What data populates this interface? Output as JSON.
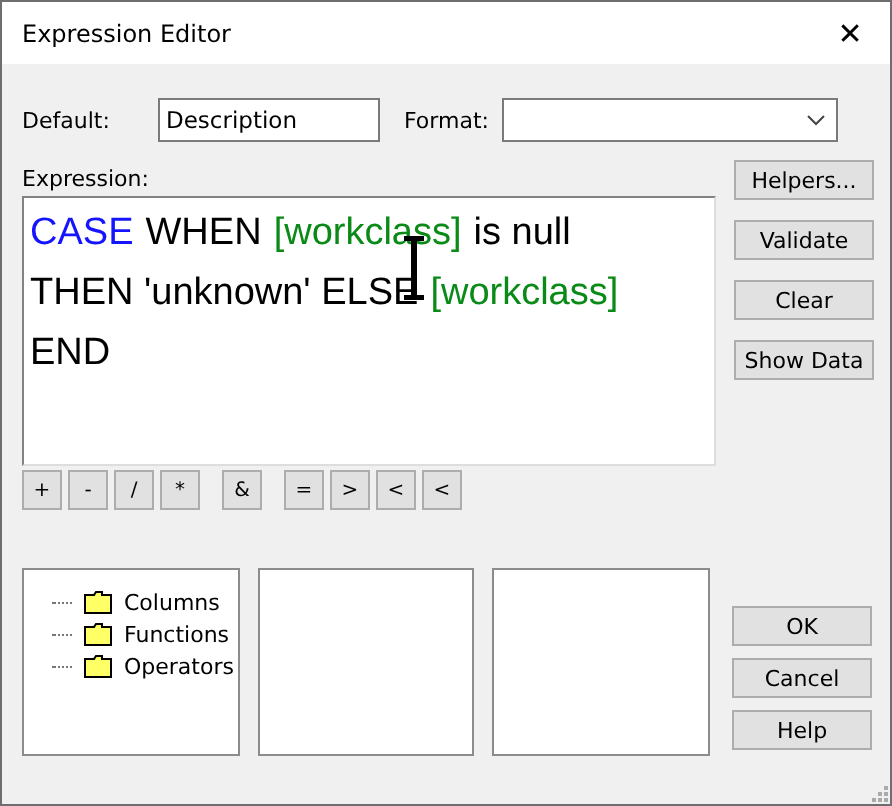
{
  "window": {
    "title": "Expression Editor",
    "close": "✕"
  },
  "default": {
    "label": "Default:",
    "value": "Description"
  },
  "format": {
    "label": "Format:"
  },
  "expression": {
    "label": "Expression:",
    "lines": [
      [
        {
          "text": "CASE",
          "kind": "keyword"
        },
        {
          "text": "WHEN",
          "kind": "plain"
        },
        {
          "text": "[workclass]",
          "kind": "column"
        },
        {
          "text": "is null",
          "kind": "plain"
        }
      ],
      [
        {
          "text": "THEN 'unknown' ELSE",
          "kind": "plain"
        },
        {
          "text": "[workclass]",
          "kind": "column"
        }
      ],
      [
        {
          "text": "END",
          "kind": "plain"
        }
      ]
    ]
  },
  "side_buttons": [
    "Helpers...",
    "Validate",
    "Clear",
    "Show Data"
  ],
  "operator_groups": [
    [
      "+",
      "-",
      "/",
      "*"
    ],
    [
      "&"
    ],
    [
      "=",
      ">",
      "<",
      "<"
    ]
  ],
  "tree": {
    "items": [
      {
        "label": "Columns"
      },
      {
        "label": "Functions"
      },
      {
        "label": "Operators"
      }
    ]
  },
  "dialog_buttons": [
    "OK",
    "Cancel",
    "Help"
  ]
}
